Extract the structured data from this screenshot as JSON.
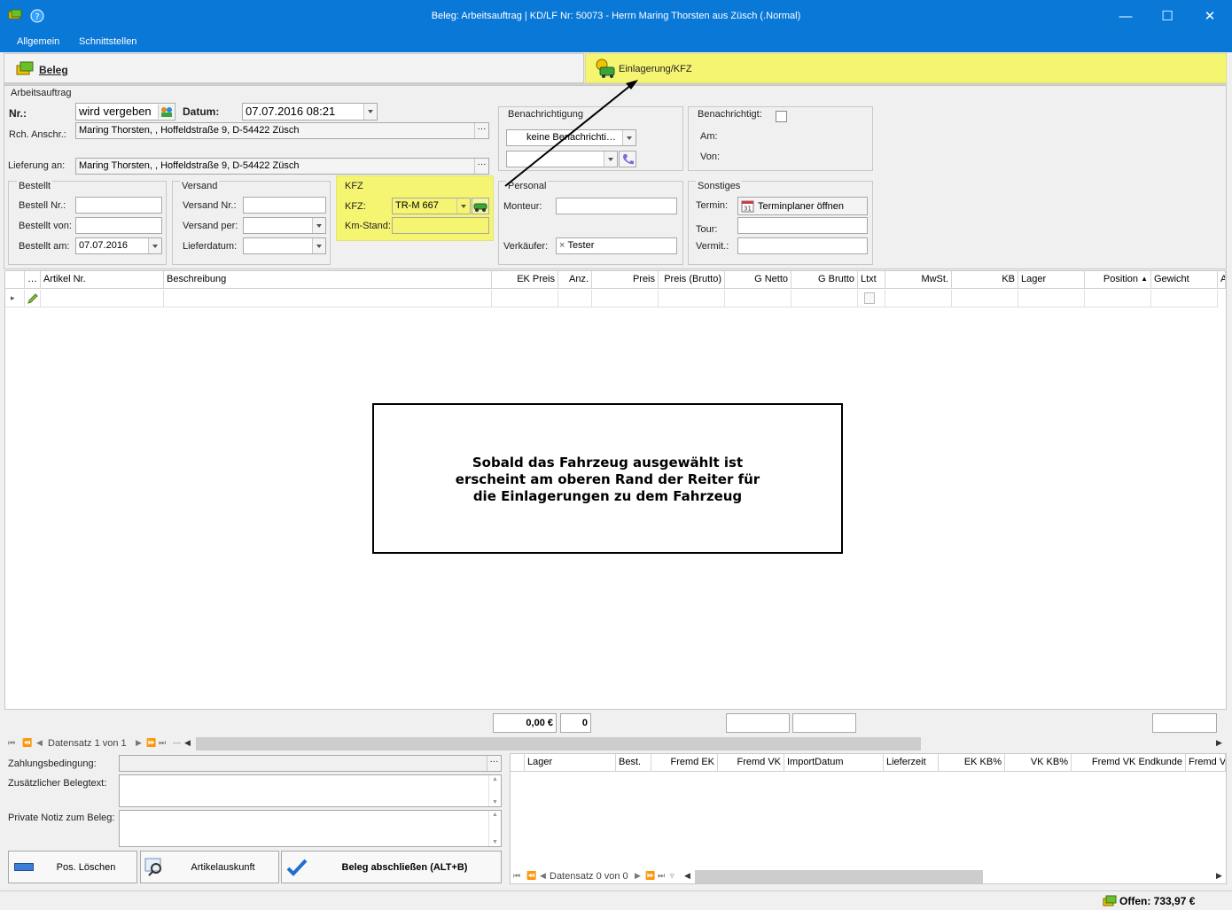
{
  "window": {
    "title": "Beleg: Arbeitsauftrag | KD/LF Nr: 50073 - Herrn Maring Thorsten aus Züsch (.Normal)",
    "minimize": "—",
    "maximize": "☐",
    "close": "✕"
  },
  "menu": {
    "items": [
      "Allgemein",
      "Schnittstellen"
    ]
  },
  "tabs": {
    "beleg": "Beleg",
    "einlagerung": "Einlagerung/KFZ"
  },
  "arbeitsauftrag": {
    "section": "Arbeitsauftrag",
    "nr_label": "Nr.:",
    "nr_value": "wird vergeben",
    "datum_label": "Datum:",
    "datum_value": "07.07.2016 08:21",
    "rch_label": "Rch. Anschr.:",
    "rch_value": "Maring Thorsten, , Hoffeldstraße 9, D-54422 Züsch",
    "lief_label": "Lieferung an:",
    "lief_value": "Maring Thorsten, , Hoffeldstraße 9, D-54422 Züsch",
    "dots": "···"
  },
  "benachrichtigung": {
    "title": "Benachrichtigung",
    "select_value": "keine Benachrichti…",
    "select2_value": ""
  },
  "benachrichtigt": {
    "title": "Benachrichtigt:",
    "am_label": "Am:",
    "von_label": "Von:"
  },
  "bestellt": {
    "title": "Bestellt",
    "nr_label": "Bestell Nr.:",
    "von_label": "Bestellt von:",
    "am_label": "Bestellt am:",
    "am_value": "07.07.2016"
  },
  "versand": {
    "title": "Versand",
    "nr_label": "Versand Nr.:",
    "per_label": "Versand per:",
    "datum_label": "Lieferdatum:"
  },
  "kfz": {
    "title": "KFZ",
    "kfz_label": "KFZ:",
    "kfz_value": "TR-M 667",
    "km_label": "Km-Stand:"
  },
  "personal": {
    "title": "Personal",
    "monteur_label": "Monteur:",
    "verkaeufer_label": "Verkäufer:",
    "verkaeufer_value": "Tester",
    "clear": "×"
  },
  "sonstiges": {
    "title": "Sonstiges",
    "termin_label": "Termin:",
    "termin_button": "Terminplaner öffnen",
    "tour_label": "Tour:",
    "vermit_label": "Vermit.:"
  },
  "grid": {
    "columns": [
      "…",
      "Artikel Nr.",
      "Beschreibung",
      "EK Preis",
      "Anz.",
      "Preis",
      "Preis (Brutto)",
      "G Netto",
      "G Brutto",
      "Ltxt",
      "MwSt.",
      "KB",
      "Lager",
      "Position",
      "Gewicht",
      "A"
    ],
    "sort_indicator": "▲",
    "row_marker": "▸",
    "totals": {
      "sum": "0,00 €",
      "count": "0"
    },
    "nav": {
      "record": "Datensatz 1 von 1"
    }
  },
  "annotation": {
    "text": "Sobald das Fahrzeug ausgewählt ist erscheint am oberen Rand der Reiter für die Einlagerungen zu dem Fahrzeug"
  },
  "bottom_left": {
    "zahlung_label": "Zahlungsbedingung:",
    "belegtext_label": "Zusätzlicher Belegtext:",
    "notiz_label": "Private Notiz zum Beleg:"
  },
  "buttons": {
    "pos_loeschen": "Pos. Löschen",
    "artikelauskunft": "Artikelauskunft",
    "beleg_abschliessen": "Beleg abschließen (ALT+B)"
  },
  "lager_grid": {
    "columns": [
      "Lager",
      "Best.",
      "Fremd EK",
      "Fremd VK",
      "ImportDatum",
      "Lieferzeit",
      "EK KB%",
      "VK KB%",
      "Fremd VK Endkunde",
      "Fremd V"
    ],
    "nav": {
      "record": "Datensatz 0 von 0"
    }
  },
  "status": {
    "offen": "Offen: 733,97 €"
  },
  "colors": {
    "titlebar": "#0a78d7",
    "highlight": "#f6f571",
    "accent_check": "#1f6fd0"
  }
}
